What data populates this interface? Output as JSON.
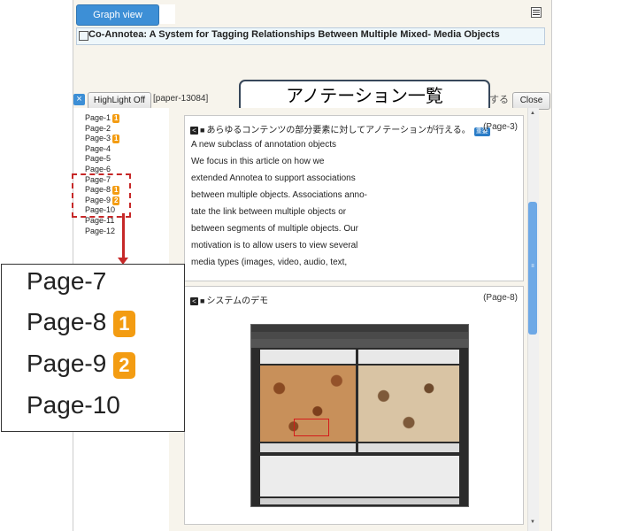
{
  "header": {
    "graph_view_label": "Graph view",
    "paper_title": "Co-Annotea: A System for Tagging Relationships Between Multiple Mixed- Media Objects"
  },
  "toolbar": {
    "close_x_label": "×",
    "highlight_label": "HighLight Off",
    "paper_id": "[paper-13084]",
    "annotation_list_title": "アノテーション一覧",
    "partial_text": "する",
    "close_label": "Close"
  },
  "nav": {
    "pages": [
      {
        "label": "Page-1",
        "count": "1"
      },
      {
        "label": "Page-2",
        "count": ""
      },
      {
        "label": "Page-3",
        "count": "1"
      },
      {
        "label": "Page-4",
        "count": ""
      },
      {
        "label": "Page-5",
        "count": ""
      },
      {
        "label": "Page-6",
        "count": ""
      },
      {
        "label": "Page-7",
        "count": ""
      },
      {
        "label": "Page-8",
        "count": "1"
      },
      {
        "label": "Page-9",
        "count": "2"
      },
      {
        "label": "Page-10",
        "count": ""
      },
      {
        "label": "Page-11",
        "count": ""
      },
      {
        "label": "Page-12",
        "count": ""
      }
    ]
  },
  "annotations": [
    {
      "heading": "あらゆるコンテンツの部分要素に対してアノテーションが行える。",
      "tag": "重要",
      "page": "(Page-3)",
      "lines": [
        "A new subclass of annotation objects",
        "We focus in this article on how we",
        "extended Annotea to support associations",
        "between multiple objects. Associations anno-",
        "tate the link between multiple objects or",
        "between segments of multiple objects. Our",
        "motivation is to allow users to view several",
        "media types (images, video, audio, text,"
      ]
    },
    {
      "heading": "システムのデモ",
      "page": "(Page-8)"
    }
  ],
  "zoom_inset": {
    "items": [
      {
        "label": "Page-7",
        "count": ""
      },
      {
        "label": "Page-8",
        "count": "1"
      },
      {
        "label": "Page-9",
        "count": "2"
      },
      {
        "label": "Page-10",
        "count": ""
      }
    ]
  },
  "colors": {
    "accent": "#3d8fd6",
    "badge": "#f39c12",
    "highlight_dash": "#c62828"
  }
}
